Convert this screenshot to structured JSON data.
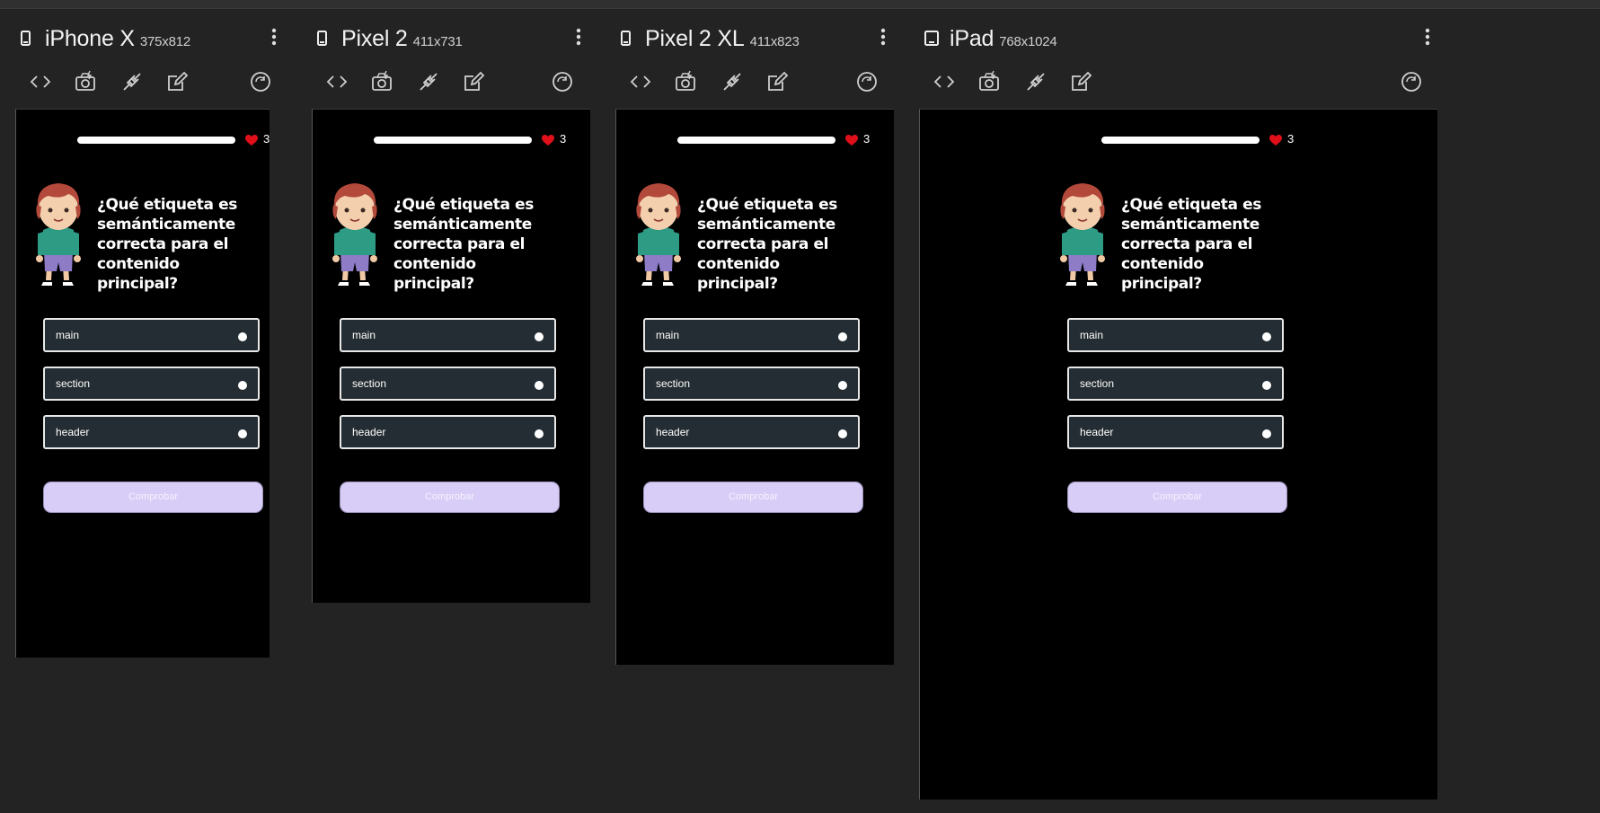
{
  "devices": [
    {
      "name": "iPhone X",
      "size": "375x812"
    },
    {
      "name": "Pixel 2",
      "size": "411x731"
    },
    {
      "name": "Pixel 2 XL",
      "size": "411x823"
    },
    {
      "name": "iPad",
      "size": "768x1024"
    }
  ],
  "toolbar": {
    "icons": [
      "code-icon",
      "camera-icon",
      "plug-icon",
      "edit-icon",
      "rotate-icon"
    ]
  },
  "quiz": {
    "lives": "3",
    "question": "¿Qué etiqueta es semánticamente correcta para el contenido principal?",
    "options": [
      "main",
      "section",
      "header"
    ],
    "check_label": "Comprobar",
    "progress": 1.0
  },
  "colors": {
    "background": "#232323",
    "screen": "#000000",
    "option_bg": "#232d33",
    "button": "#d7cdf6",
    "heart": "#e0101a"
  }
}
